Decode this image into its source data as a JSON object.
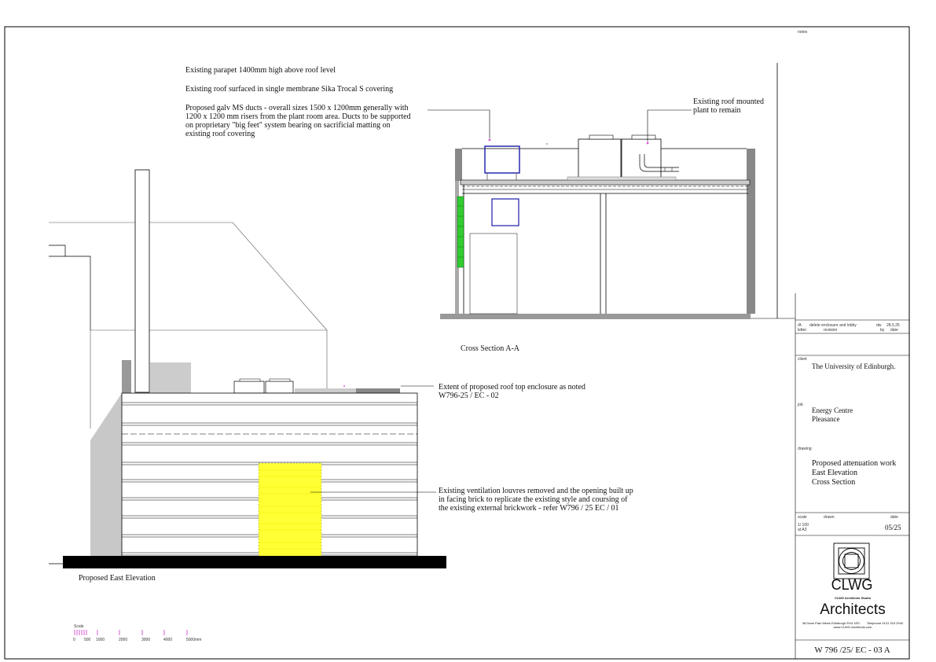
{
  "sheet": {
    "notes_label": "notes",
    "drawing_number": "W 796 /25/ EC - 03 A"
  },
  "annotations": {
    "parapet": "Existing parapet 1400mm high above roof level",
    "roof_covering": "Existing roof surfaced in single membrane Sika Trocal S covering",
    "ducts": "Proposed galv MS ducts - overall sizes 1500 x 1200mm generally with\n1200 x 1200 mm risers from the plant room area. Ducts to be supported\non proprietary \"big feet\" system bearing on sacrificial matting on\nexisting roof covering",
    "plant": "Existing roof mounted\n plant to remain",
    "enclosure": "Extent of proposed roof top enclosure as noted\nW796-25 / EC - 02",
    "louvres": "Existing ventilation louvres removed and the opening built up\nin facing brick to replicate the  existing style and coursing of\nthe existing external brickwork - refer W796 / 25 EC / 01",
    "cross_section_title": "Cross Section  A-A",
    "elevation_title": "Proposed East Elevation"
  },
  "title_block": {
    "revision": {
      "code": "/A",
      "description": "delete enclosure  and lobby",
      "by": "dw",
      "date": "28.5.25",
      "col_letter": "letter",
      "col_revision": "revision",
      "col_by": "by",
      "col_date": "date"
    },
    "client_label": "client",
    "client": "The University of Edinburgh.",
    "job_label": "job",
    "job": "Energy Centre\nPleasance",
    "drawing_label": "drawing",
    "drawing": "Proposed attenuation work\nEast Elevation\nCross Section",
    "scale_label": "scale",
    "drawn_label": "drawn",
    "date_label": "date",
    "scale_value": "1/ 100\nat A3",
    "date_value": "05/25",
    "logo_name": "CLWG",
    "logo_subtitle": "CLWG Architects Studio",
    "architects": "Architects",
    "address": "38 Dean Park Mews Edinburgh EH4 1ED        Telephone 0131 315 2940",
    "website": "www.CLWG-Architects.com"
  },
  "scale_bar": {
    "label": "Scale",
    "ticks": [
      "0",
      "500",
      "1000",
      "2000",
      "3000",
      "4000",
      "5000mm"
    ],
    "color": "#cc33cc"
  },
  "colors": {
    "brick_infill": "#ffff33",
    "planting_wall": "#33cc33",
    "duct": "#1a1aaa",
    "grey_fill": "#c8c8c8",
    "dark_grey": "#888888"
  }
}
